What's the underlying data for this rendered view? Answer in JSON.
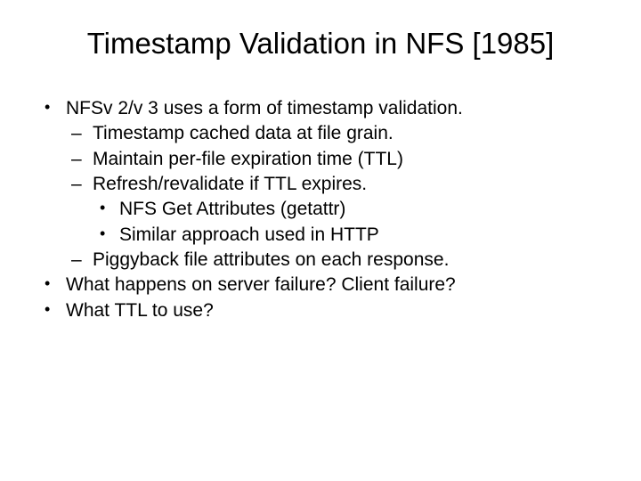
{
  "title": "Timestamp Validation in NFS [1985]",
  "bullets": {
    "b1": "NFSv 2/v 3 uses a form of timestamp validation.",
    "b1a": "Timestamp cached data at file grain.",
    "b1b": "Maintain per-file expiration time (TTL)",
    "b1c": "Refresh/revalidate if TTL expires.",
    "b1c1": "NFS Get Attributes (getattr)",
    "b1c2": "Similar approach used in HTTP",
    "b1d": "Piggyback file attributes on each response.",
    "b2": "What happens on server failure?  Client failure?",
    "b3": "What TTL to use?"
  }
}
